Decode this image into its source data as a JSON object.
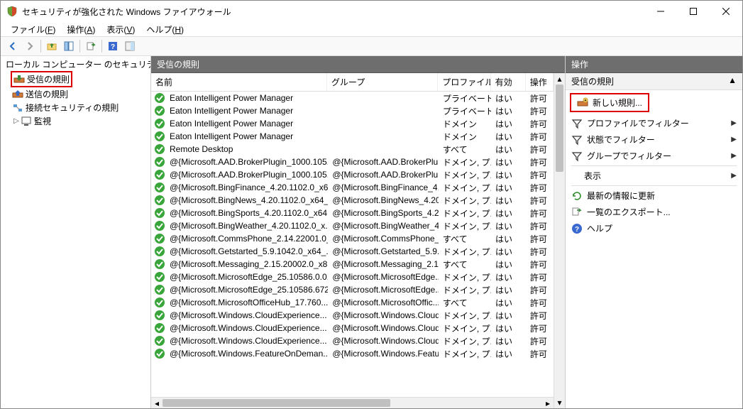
{
  "window": {
    "title": "セキュリティが強化された Windows ファイアウォール"
  },
  "menubar": {
    "file": "ファイル(F)",
    "action": "操作(A)",
    "view": "表示(V)",
    "help": "ヘルプ(H)"
  },
  "tree": {
    "root": "ローカル コンピューター のセキュリティ",
    "inbound": "受信の規則",
    "outbound": "送信の規則",
    "connsec": "接続セキュリティの規則",
    "monitor": "監視"
  },
  "centerHeader": "受信の規則",
  "columns": {
    "name": "名前",
    "group": "グループ",
    "profile": "プロファイル",
    "enabled": "有効",
    "action": "操作"
  },
  "rows": [
    {
      "name": "Eaton Intelligent Power Manager",
      "group": "",
      "profile": "プライベート",
      "enabled": "はい",
      "action": "許可"
    },
    {
      "name": "Eaton Intelligent Power Manager",
      "group": "",
      "profile": "プライベート",
      "enabled": "はい",
      "action": "許可"
    },
    {
      "name": "Eaton Intelligent Power Manager",
      "group": "",
      "profile": "ドメイン",
      "enabled": "はい",
      "action": "許可"
    },
    {
      "name": "Eaton Intelligent Power Manager",
      "group": "",
      "profile": "ドメイン",
      "enabled": "はい",
      "action": "許可"
    },
    {
      "name": "Remote Desktop",
      "group": "",
      "profile": "すべて",
      "enabled": "はい",
      "action": "許可"
    },
    {
      "name": "@{Microsoft.AAD.BrokerPlugin_1000.105...",
      "group": "@{Microsoft.AAD.BrokerPlu...",
      "profile": "ドメイン, プ...",
      "enabled": "はい",
      "action": "許可"
    },
    {
      "name": "@{Microsoft.AAD.BrokerPlugin_1000.105...",
      "group": "@{Microsoft.AAD.BrokerPlu...",
      "profile": "ドメイン, プ...",
      "enabled": "はい",
      "action": "許可"
    },
    {
      "name": "@{Microsoft.BingFinance_4.20.1102.0_x6...",
      "group": "@{Microsoft.BingFinance_4...",
      "profile": "ドメイン, プ...",
      "enabled": "はい",
      "action": "許可"
    },
    {
      "name": "@{Microsoft.BingNews_4.20.1102.0_x64_...",
      "group": "@{Microsoft.BingNews_4.20...",
      "profile": "ドメイン, プ...",
      "enabled": "はい",
      "action": "許可"
    },
    {
      "name": "@{Microsoft.BingSports_4.20.1102.0_x64...",
      "group": "@{Microsoft.BingSports_4.2...",
      "profile": "ドメイン, プ...",
      "enabled": "はい",
      "action": "許可"
    },
    {
      "name": "@{Microsoft.BingWeather_4.20.1102.0_x...",
      "group": "@{Microsoft.BingWeather_4...",
      "profile": "ドメイン, プ...",
      "enabled": "はい",
      "action": "許可"
    },
    {
      "name": "@{Microsoft.CommsPhone_2.14.22001.0_...",
      "group": "@{Microsoft.CommsPhone_...",
      "profile": "すべて",
      "enabled": "はい",
      "action": "許可"
    },
    {
      "name": "@{Microsoft.Getstarted_5.9.1042.0_x64_...",
      "group": "@{Microsoft.Getstarted_5.9...",
      "profile": "ドメイン, プ...",
      "enabled": "はい",
      "action": "許可"
    },
    {
      "name": "@{Microsoft.Messaging_2.15.20002.0_x86...",
      "group": "@{Microsoft.Messaging_2.1...",
      "profile": "すべて",
      "enabled": "はい",
      "action": "許可"
    },
    {
      "name": "@{Microsoft.MicrosoftEdge_25.10586.0.0...",
      "group": "@{Microsoft.MicrosoftEdge...",
      "profile": "ドメイン, プ...",
      "enabled": "はい",
      "action": "許可"
    },
    {
      "name": "@{Microsoft.MicrosoftEdge_25.10586.672...",
      "group": "@{Microsoft.MicrosoftEdge...",
      "profile": "ドメイン, プ...",
      "enabled": "はい",
      "action": "許可"
    },
    {
      "name": "@{Microsoft.MicrosoftOfficeHub_17.760...",
      "group": "@{Microsoft.MicrosoftOffic...",
      "profile": "すべて",
      "enabled": "はい",
      "action": "許可"
    },
    {
      "name": "@{Microsoft.Windows.CloudExperience...",
      "group": "@{Microsoft.Windows.Cloud...",
      "profile": "ドメイン, プ...",
      "enabled": "はい",
      "action": "許可"
    },
    {
      "name": "@{Microsoft.Windows.CloudExperience...",
      "group": "@{Microsoft.Windows.Cloud...",
      "profile": "ドメイン, プ...",
      "enabled": "はい",
      "action": "許可"
    },
    {
      "name": "@{Microsoft.Windows.CloudExperience...",
      "group": "@{Microsoft.Windows.Cloud...",
      "profile": "ドメイン, プ...",
      "enabled": "はい",
      "action": "許可"
    },
    {
      "name": "@{Microsoft.Windows.FeatureOnDeman...",
      "group": "@{Microsoft.Windows.Featur...",
      "profile": "ドメイン, プ...",
      "enabled": "はい",
      "action": "許可"
    }
  ],
  "actions": {
    "header": "操作",
    "subheader": "受信の規則",
    "newRule": "新しい規則...",
    "filterProfile": "プロファイルでフィルター",
    "filterState": "状態でフィルター",
    "filterGroup": "グループでフィルター",
    "view": "表示",
    "refresh": "最新の情報に更新",
    "export": "一覧のエクスポート...",
    "help": "ヘルプ"
  }
}
